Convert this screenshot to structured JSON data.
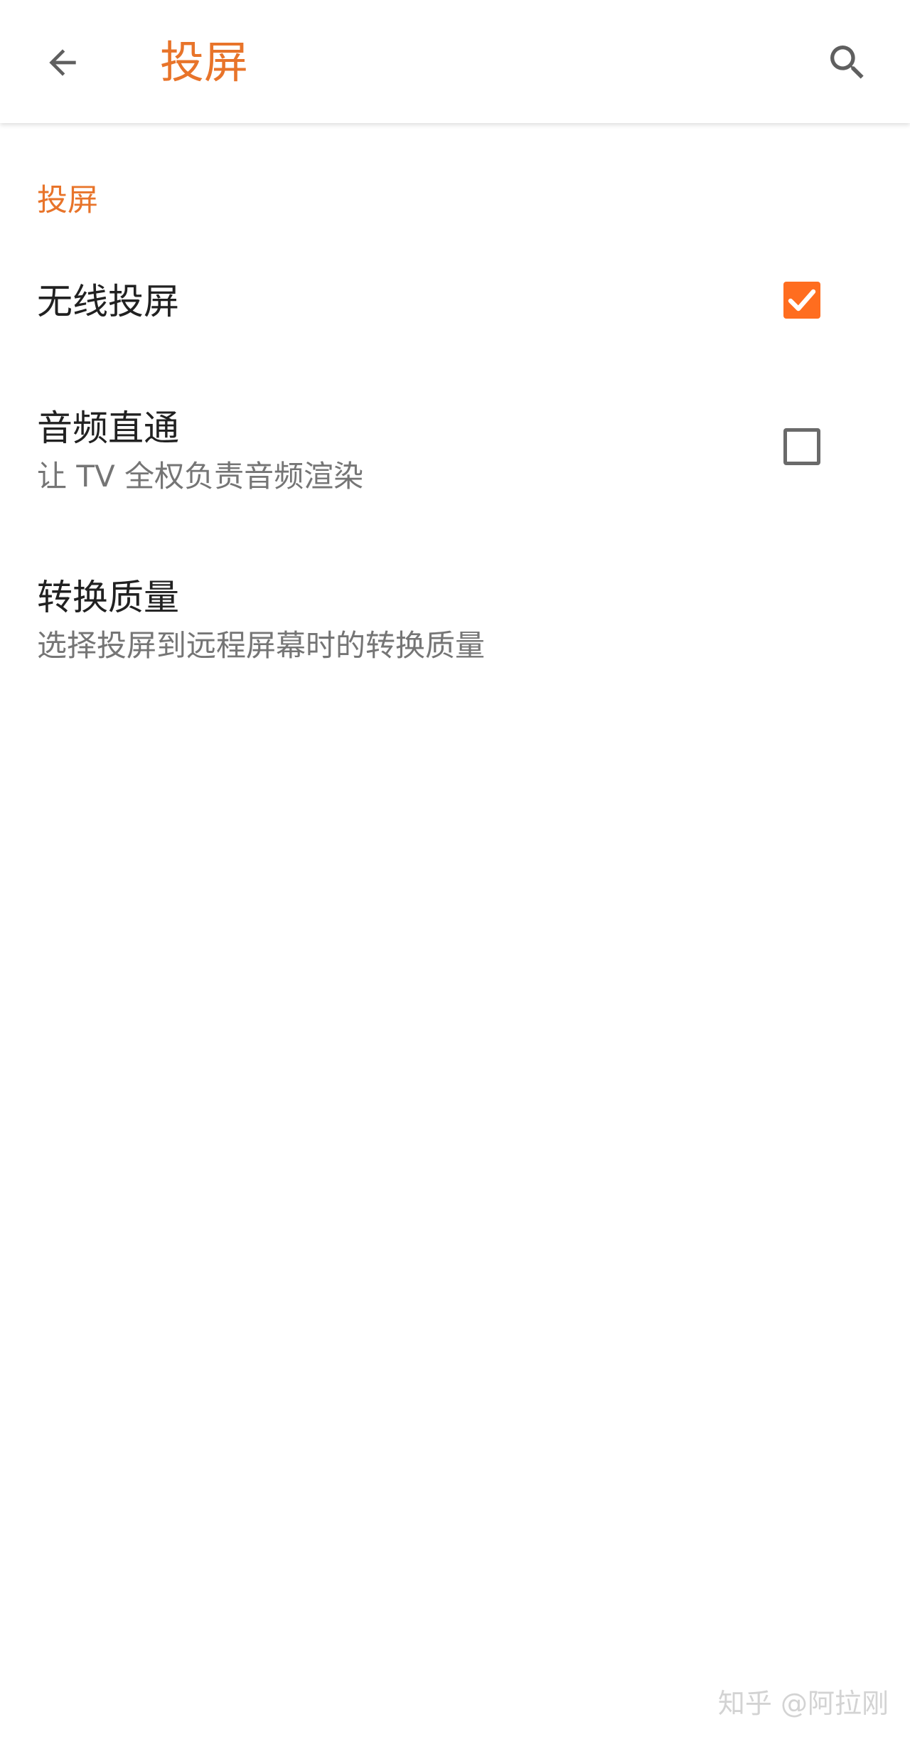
{
  "appbar": {
    "title": "投屏",
    "back_icon": "arrow-left-icon",
    "search_icon": "search-icon",
    "accent_color": "#e8742a"
  },
  "category": {
    "title": "投屏"
  },
  "preferences": [
    {
      "title": "无线投屏",
      "summary": "",
      "checkbox": true,
      "checked": true
    },
    {
      "title": "音频直通",
      "summary": "让 TV 全权负责音频渲染",
      "checkbox": true,
      "checked": false
    },
    {
      "title": "转换质量",
      "summary": "选择投屏到远程屏幕时的转换质量",
      "checkbox": false
    }
  ],
  "colors": {
    "checkbox_checked": "#ff6d1f",
    "checkbox_unchecked_border": "#6a6a6a",
    "primary_text": "#212121",
    "secondary_text": "#757575"
  },
  "watermark": {
    "text": "知乎 @阿拉刚"
  }
}
